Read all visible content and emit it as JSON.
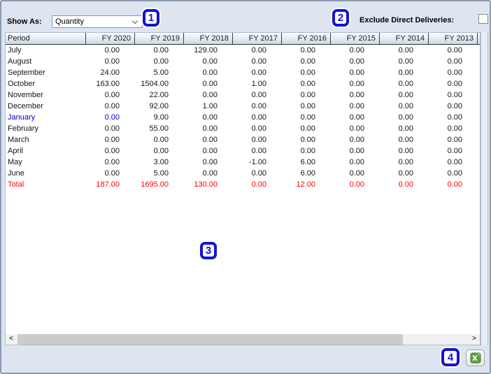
{
  "toolbar": {
    "show_as_label": "Show As:",
    "dropdown_value": "Quantity",
    "exclude_label": "Exclude Direct Deliveries:",
    "exclude_checked": false
  },
  "annotations": {
    "a1": "1",
    "a2": "2",
    "a3": "3",
    "a4": "4"
  },
  "icons": {
    "scroll_left": "<",
    "scroll_right": ">",
    "dropdown_chevron": "chevron-down",
    "excel": "excel-spreadsheet"
  },
  "colors": {
    "annotation_blue": "#1414d2",
    "total_red": "#ff0000",
    "current_period_blue": "#0000cd",
    "excel_green": "#5ba344",
    "window_chrome": "#dee5f0",
    "header_gradient_top": "#fbfdfe",
    "header_gradient_bottom": "#ccd9ea"
  },
  "table": {
    "columns": [
      "Period",
      "FY 2020",
      "FY 2019",
      "FY 2018",
      "FY 2017",
      "FY 2016",
      "FY 2015",
      "FY 2014",
      "FY 2013"
    ],
    "rows": [
      {
        "label": "July",
        "style": "normal",
        "values": [
          "0.00",
          "0.00",
          "129.00",
          "0.00",
          "0.00",
          "0.00",
          "0.00",
          "0.00"
        ]
      },
      {
        "label": "August",
        "style": "normal",
        "values": [
          "0.00",
          "0.00",
          "0.00",
          "0.00",
          "0.00",
          "0.00",
          "0.00",
          "0.00"
        ]
      },
      {
        "label": "September",
        "style": "normal",
        "values": [
          "24.00",
          "5.00",
          "0.00",
          "0.00",
          "0.00",
          "0.00",
          "0.00",
          "0.00"
        ]
      },
      {
        "label": "October",
        "style": "normal",
        "values": [
          "163.00",
          "1504.00",
          "0.00",
          "1.00",
          "0.00",
          "0.00",
          "0.00",
          "0.00"
        ]
      },
      {
        "label": "November",
        "style": "normal",
        "values": [
          "0.00",
          "22.00",
          "0.00",
          "0.00",
          "0.00",
          "0.00",
          "0.00",
          "0.00"
        ]
      },
      {
        "label": "December",
        "style": "normal",
        "values": [
          "0.00",
          "92.00",
          "1.00",
          "0.00",
          "0.00",
          "0.00",
          "0.00",
          "0.00"
        ]
      },
      {
        "label": "January",
        "style": "current",
        "values": [
          "0.00",
          "9.00",
          "0.00",
          "0.00",
          "0.00",
          "0.00",
          "0.00",
          "0.00"
        ]
      },
      {
        "label": "February",
        "style": "normal",
        "values": [
          "0.00",
          "55.00",
          "0.00",
          "0.00",
          "0.00",
          "0.00",
          "0.00",
          "0.00"
        ]
      },
      {
        "label": "March",
        "style": "normal",
        "values": [
          "0.00",
          "0.00",
          "0.00",
          "0.00",
          "0.00",
          "0.00",
          "0.00",
          "0.00"
        ]
      },
      {
        "label": "April",
        "style": "normal",
        "values": [
          "0.00",
          "0.00",
          "0.00",
          "0.00",
          "0.00",
          "0.00",
          "0.00",
          "0.00"
        ]
      },
      {
        "label": "May",
        "style": "normal",
        "values": [
          "0.00",
          "3.00",
          "0.00",
          "-1.00",
          "6.00",
          "0.00",
          "0.00",
          "0.00"
        ]
      },
      {
        "label": "June",
        "style": "normal",
        "values": [
          "0.00",
          "5.00",
          "0.00",
          "0.00",
          "6.00",
          "0.00",
          "0.00",
          "0.00"
        ]
      },
      {
        "label": "Total",
        "style": "total",
        "values": [
          "187.00",
          "1695.00",
          "130.00",
          "0.00",
          "12.00",
          "0.00",
          "0.00",
          "0.00"
        ]
      }
    ]
  }
}
